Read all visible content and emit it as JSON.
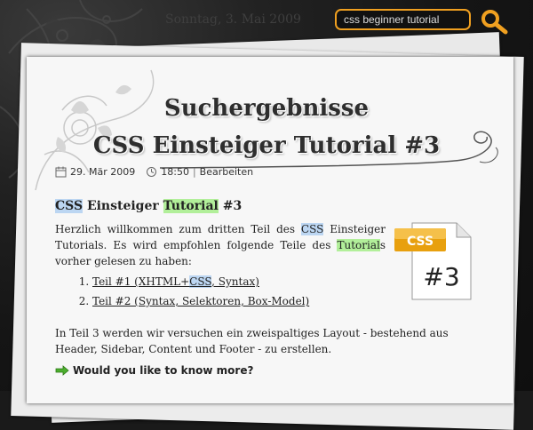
{
  "header": {
    "date": "Sonntag, 3. Mai 2009",
    "search_value": "css beginner tutorial"
  },
  "page": {
    "heading": "Suchergebnisse",
    "article_title": "CSS Einsteiger Tutorial #3"
  },
  "meta": {
    "date": "29. Mär 2009",
    "time": "18:50",
    "separator": "|",
    "edit_label": "Bearbeiten"
  },
  "post": {
    "title_parts": [
      "CSS",
      "Einsteiger",
      "Tutorial",
      "#3"
    ],
    "intro_1": "Herzlich willkommen zum dritten Teil des ",
    "intro_css": "CSS",
    "intro_2": " Einsteiger Tutorials. Es wird empfohlen folgende Teile des ",
    "intro_tutorial": "Tutorial",
    "intro_3": "s vorher gelesen zu haben:",
    "logo_label": "CSS",
    "logo_number": "#3",
    "links": [
      {
        "a": "Teil #1 (XHTML+",
        "hl": "CSS",
        "b": ", Syntax)"
      },
      {
        "a": "Teil #2 (Syntax, Selektoren, Box-Model)",
        "hl": "",
        "b": ""
      }
    ],
    "paragraph": "In Teil 3 werden wir versuchen ein zweispaltiges Layout - bestehend aus Header, Sidebar, Content und Footer - zu erstellen.",
    "more_label": "Would you like to know more?"
  },
  "colors": {
    "accent": "#f0a020",
    "highlight_blue": "#bcd6f2",
    "highlight_green": "#b2ef9a"
  }
}
